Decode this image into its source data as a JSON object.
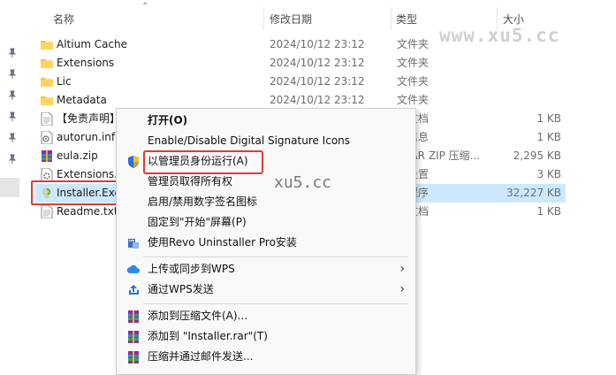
{
  "header": {
    "name": "名称",
    "date": "修改日期",
    "type": "类型",
    "size": "大小"
  },
  "files": [
    {
      "name": "Altium Cache",
      "date": "2024/10/12 23:12",
      "type": "文件夹",
      "size": "",
      "icon": "folder-icon"
    },
    {
      "name": "Extensions",
      "date": "2024/10/12 23:12",
      "type": "文件夹",
      "size": "",
      "icon": "folder-icon"
    },
    {
      "name": "Lic",
      "date": "2024/10/12 23:12",
      "type": "文件夹",
      "size": "",
      "icon": "folder-icon"
    },
    {
      "name": "Metadata",
      "date": "2024/10/12 23:12",
      "type": "文件夹",
      "size": "",
      "icon": "folder-icon"
    },
    {
      "name": "【免责声明】",
      "date": "",
      "type": "本文档",
      "size": "1 KB",
      "icon": "text-file-icon"
    },
    {
      "name": "autorun.inf",
      "date": "",
      "type": "装信息",
      "size": "1 KB",
      "icon": "inf-file-icon"
    },
    {
      "name": "eula.zip",
      "date": "",
      "type": "nRAR ZIP 压缩...",
      "size": "2,295 KB",
      "icon": "zip-file-icon"
    },
    {
      "name": "Extensions.i",
      "date": "",
      "type": "置设置",
      "size": "3 KB",
      "icon": "ini-file-icon"
    },
    {
      "name": "Installer.Exe",
      "date": "",
      "type": "用程序",
      "size": "32,227 KB",
      "icon": "installer-app-icon"
    },
    {
      "name": "Readme.txt",
      "date": "",
      "type": "本文档",
      "size": "1 KB",
      "icon": "text-file-icon"
    }
  ],
  "watermark": {
    "top": "www.xu5.cc",
    "middle": "xu5.cc"
  },
  "context_menu": {
    "open": "打开(O)",
    "signature": "Enable/Disable Digital Signature Icons",
    "run_as_admin": "以管理员身份运行(A)",
    "take_ownership": "管理员取得所有权",
    "toggle_signature": "启用/禁用数字签名图标",
    "pin_start": "固定到\"开始\"屏幕(P)",
    "revo": "使用Revo Uninstaller Pro安装",
    "wps_upload": "上传或同步到WPS",
    "wps_send": "通过WPS发送",
    "add_archive": "添加到压缩文件(A)...",
    "add_rar": "添加到 \"Installer.rar\"(T)",
    "compress_email": "压缩并通过邮件发送...",
    "submenu_arrow": "›"
  },
  "colors": {
    "selection": "#cce8ff",
    "highlight_box": "#e53935",
    "folder": "#f4c04a"
  }
}
